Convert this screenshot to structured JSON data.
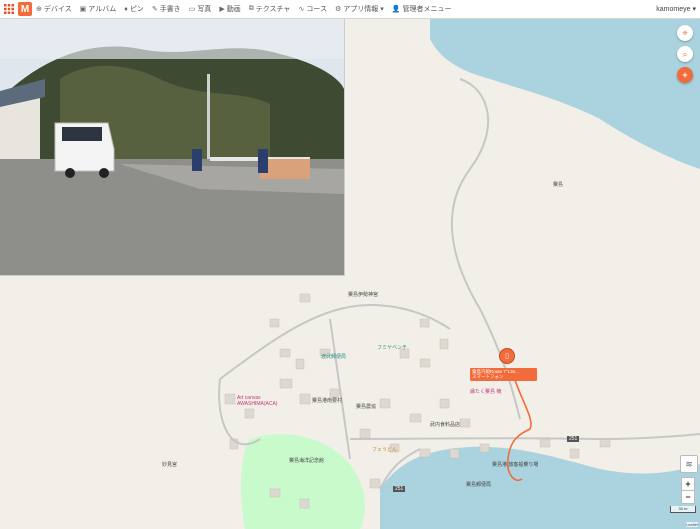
{
  "nav": {
    "items": [
      {
        "icon": "⊕",
        "label": "デバイス"
      },
      {
        "icon": "▣",
        "label": "アルバム"
      },
      {
        "icon": "♦",
        "label": "ピン"
      },
      {
        "icon": "✎",
        "label": "手書き"
      },
      {
        "icon": "▭",
        "label": "写真"
      },
      {
        "icon": "▶",
        "label": "動画"
      },
      {
        "icon": "⧉",
        "label": "テクスチャ"
      },
      {
        "icon": "∿",
        "label": "コース"
      },
      {
        "icon": "⚙",
        "label": "アプリ情報"
      },
      {
        "icon": "👤",
        "label": "管理者メニュー"
      }
    ],
    "logo": "M"
  },
  "user": {
    "name": "kamomeye"
  },
  "map": {
    "labels": {
      "awa_shima": "粟島",
      "iyo_jinja": "粟島伊勢神宮",
      "fumiya": "フミヤベンチ",
      "post": "渡武郵便局",
      "art": "Art canvas AWASHIMA(ACA)",
      "kyodo": "粟島港南要村",
      "nokyo": "粟島農協",
      "takeuchi": "武内食料品店",
      "sushi": "縁たく粟島 楠",
      "fuku": "フェうどん",
      "kaido": "粟島海洋記念館",
      "yubin2": "粟島郵便局",
      "port": "粟島港 旅客船乗り場",
      "myoken": "妙見宮",
      "r251a": "251",
      "r251b": "251",
      "scale": "30 m",
      "attribution": "Leaflet"
    },
    "popup": {
      "title": "粟島汽船Route 7°13e...",
      "sub": "スマートフォン"
    },
    "zoom_in": "+",
    "zoom_out": "−"
  },
  "colors": {
    "accent": "#f26b3a",
    "water": "#aad3df",
    "land": "#f2efe9",
    "park": "#c8facc"
  }
}
